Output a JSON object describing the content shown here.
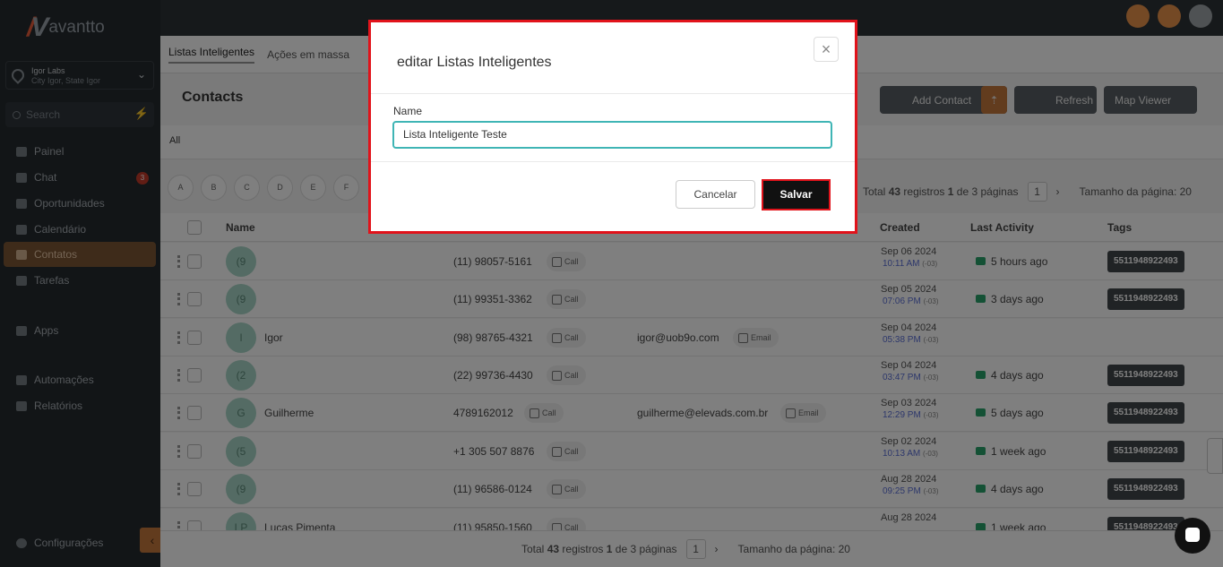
{
  "brand": {
    "name": "avantto"
  },
  "location": {
    "name": "Igor Labs",
    "sub": "City Igor, State Igor"
  },
  "search": {
    "placeholder": "Search"
  },
  "nav": [
    {
      "label": "Painel",
      "icon": "dashboard-icon"
    },
    {
      "label": "Chat",
      "icon": "chat-icon",
      "badge": "3"
    },
    {
      "label": "Oportunidades",
      "icon": "filter-icon"
    },
    {
      "label": "Calendário",
      "icon": "calendar-icon"
    },
    {
      "label": "Contatos",
      "icon": "user-icon",
      "active": true
    },
    {
      "label": "Tarefas",
      "icon": "checkbox-icon"
    },
    {
      "label": "Apps",
      "icon": "apps-icon"
    },
    {
      "label": "Automações",
      "icon": "automation-icon"
    },
    {
      "label": "Relatórios",
      "icon": "reports-icon"
    }
  ],
  "settings_label": "Configurações",
  "subnav": {
    "tab1": "Listas Inteligentes",
    "tab2": "Ações em massa"
  },
  "page": {
    "title": "Contacts"
  },
  "toolbar": {
    "add": "Add Contact",
    "refresh": "Refresh",
    "map": "Map Viewer"
  },
  "filter": {
    "all": "All"
  },
  "letters": [
    "A",
    "B",
    "C",
    "D",
    "E",
    "F"
  ],
  "pagination": {
    "prefix": "Total",
    "total": "43",
    "mid": "registros",
    "page": "1",
    "of": "de 3 páginas",
    "page_num": "1",
    "size": "Tamanho da página: 20"
  },
  "table": {
    "headers": {
      "name": "Name",
      "created": "Created",
      "activity": "Last Activity",
      "tags": "Tags"
    },
    "call_label": "Call",
    "email_label": "Email",
    "rows": [
      {
        "initial": "(9",
        "name": "",
        "phone": "(11) 98057-5161",
        "email": "",
        "date": "Sep 06 2024",
        "time": "10:11 AM",
        "tz": "(-03)",
        "activity": "5 hours ago",
        "tag": "5511948922493"
      },
      {
        "initial": "(9",
        "name": "",
        "phone": "(11) 99351-3362",
        "email": "",
        "date": "Sep 05 2024",
        "time": "07:06 PM",
        "tz": "(-03)",
        "activity": "3 days ago",
        "tag": "5511948922493"
      },
      {
        "initial": "I",
        "name": "Igor",
        "phone": "(98) 98765-4321",
        "email": "igor@uob9o.com",
        "date": "Sep 04 2024",
        "time": "05:38 PM",
        "tz": "(-03)",
        "activity": "",
        "tag": ""
      },
      {
        "initial": "(2",
        "name": "",
        "phone": "(22) 99736-4430",
        "email": "",
        "date": "Sep 04 2024",
        "time": "03:47 PM",
        "tz": "(-03)",
        "activity": "4 days ago",
        "tag": "5511948922493"
      },
      {
        "initial": "G",
        "name": "Guilherme",
        "phone": "4789162012",
        "email": "guilherme@elevads.com.br",
        "date": "Sep 03 2024",
        "time": "12:29 PM",
        "tz": "(-03)",
        "activity": "5 days ago",
        "tag": "5511948922493"
      },
      {
        "initial": "(5",
        "name": "",
        "phone": "+1 305 507 8876",
        "email": "",
        "date": "Sep 02 2024",
        "time": "10:13 AM",
        "tz": "(-03)",
        "activity": "1 week ago",
        "tag": "5511948922493"
      },
      {
        "initial": "(9",
        "name": "",
        "phone": "(11) 96586-0124",
        "email": "",
        "date": "Aug 28 2024",
        "time": "09:25 PM",
        "tz": "(-03)",
        "activity": "4 days ago",
        "tag": "5511948922493"
      },
      {
        "initial": "LP",
        "name": "Lucas Pimenta",
        "phone": "(11) 95850-1560",
        "email": "",
        "date": "Aug 28 2024",
        "time": "",
        "tz": "",
        "activity": "1 week ago",
        "tag": "5511948922493"
      }
    ]
  },
  "modal": {
    "title": "editar Listas Inteligentes",
    "field_label": "Name",
    "field_value": "Lista Inteligente Teste",
    "cancel": "Cancelar",
    "save": "Salvar"
  }
}
